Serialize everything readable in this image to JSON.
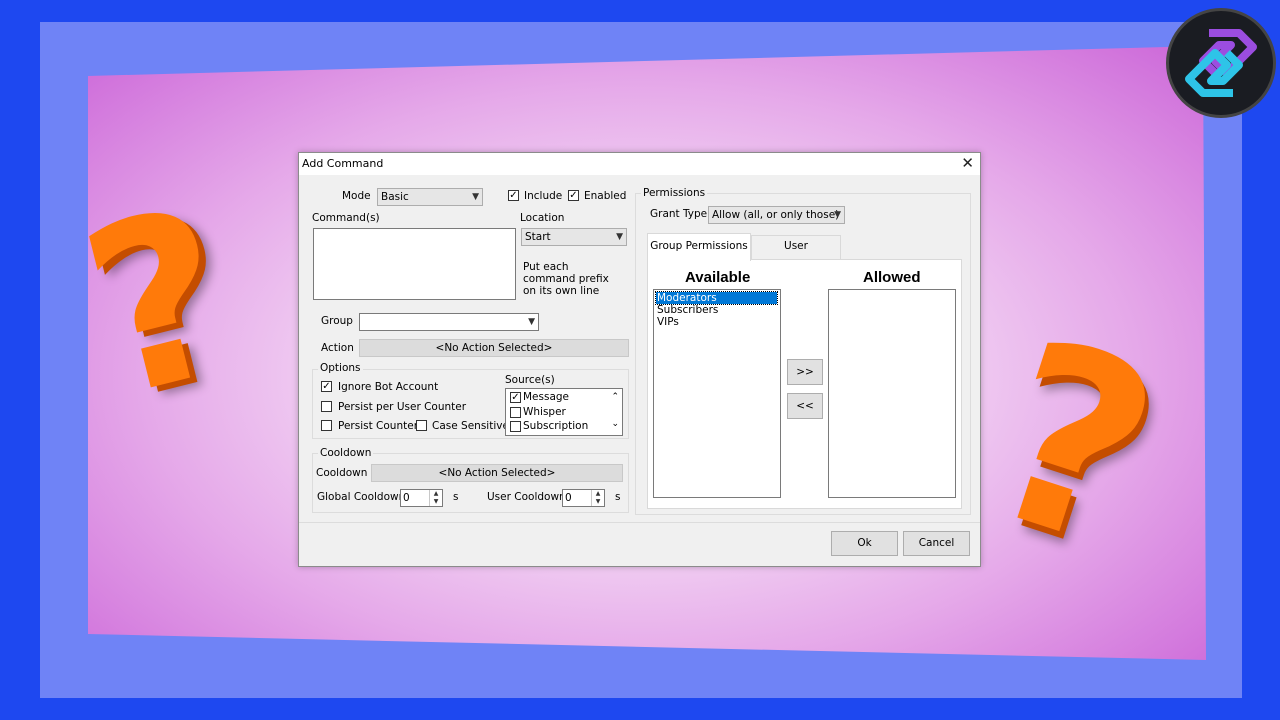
{
  "dialog": {
    "title": "Add Command",
    "mode_label": "Mode",
    "mode_value": "Basic",
    "include_label": "Include",
    "include_checked": true,
    "enabled_label": "Enabled",
    "enabled_checked": true,
    "commands_label": "Command(s)",
    "location_label": "Location",
    "location_value": "Start",
    "location_hint": "Put each command prefix on its own line",
    "group_label": "Group",
    "group_value": "",
    "action_label": "Action",
    "action_value": "<No Action Selected>",
    "options": {
      "title": "Options",
      "ignore_bot_label": "Ignore Bot Account",
      "ignore_bot_checked": true,
      "persist_user_label": "Persist per User Counter",
      "persist_counter_label": "Persist Counter",
      "case_sensitive_label": "Case Sensitive",
      "sources_label": "Source(s)",
      "sources": [
        {
          "label": "Message",
          "checked": true
        },
        {
          "label": "Whisper",
          "checked": false
        },
        {
          "label": "Subscription",
          "checked": false
        }
      ]
    },
    "cooldown": {
      "title": "Cooldown",
      "cooldown_label": "Cooldown",
      "cooldown_value": "<No Action Selected>",
      "global_label": "Global Cooldown",
      "global_value": "0",
      "user_label": "User Cooldown",
      "user_value": "0",
      "unit": "s"
    },
    "permissions": {
      "title": "Permissions",
      "grant_type_label": "Grant Type",
      "grant_type_value": "Allow (all, or only those)",
      "tabs": [
        "Group Permissions",
        "User Permissions"
      ],
      "available_header": "Available",
      "allowed_header": "Allowed",
      "available": [
        "Moderators",
        "Subscribers",
        "VIPs"
      ],
      "allowed": [],
      "add_button": ">>",
      "remove_button": "<<"
    },
    "ok_label": "Ok",
    "cancel_label": "Cancel",
    "close_glyph": "✕"
  },
  "decor": {
    "question_mark": "?",
    "accent_orange": "#ff7a0a",
    "background_blue": "#1e48f0"
  }
}
